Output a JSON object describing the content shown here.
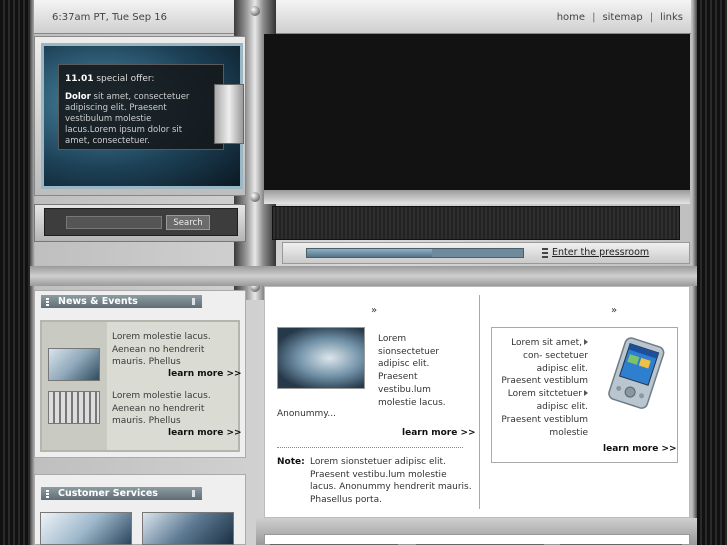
{
  "header": {
    "datetime": "6:37am PT, Tue Sep 16",
    "links": [
      "home",
      "sitemap",
      "links"
    ],
    "separator": "|"
  },
  "promo": {
    "title_number": "11.01",
    "title_text": "special offer:",
    "body_bold": "Dolor",
    "body_text": "sit amet, consectetuer adipiscing elit. Praesent vestibulum molestie lacus.Lorem ipsum dolor sit amet, consectetuer."
  },
  "search": {
    "placeholder": "",
    "button_label": "Search"
  },
  "pressroom": {
    "link_label": "Enter the pressroom",
    "progress": 0.58
  },
  "news": {
    "header": "News & Events",
    "items": [
      {
        "text": "Lorem molestie lacus. Aenean no hendrerit mauris. Phellus",
        "more": "learn more >>"
      },
      {
        "text": "Lorem molestie lacus. Aenean no hendrerit mauris. Phellus",
        "more": "learn more >>"
      }
    ]
  },
  "customer_services": {
    "header": "Customer Services"
  },
  "main": {
    "arrow": "»",
    "article": {
      "text": "Lorem sionsectetuer adipisc elit. Praesent vestibu.lum molestie lacus.",
      "tail": "Anonummy...",
      "more": "learn more >>"
    },
    "note": {
      "label": "Note:",
      "text": "Lorem sionstetuer adipisc elit. Praesent vestibu.lum molestie lacus. Anonummy hendrerit mauris. Phasellus porta."
    },
    "device": {
      "lines": [
        "Lorem sit amet,",
        "con- sectetuer",
        "adipisc elit.",
        "Praesent vestiblum",
        "Lorem sitctetuer",
        "adipisc elit.",
        "Praesent vestiblum",
        "molestie"
      ],
      "more": "learn more >>"
    }
  },
  "colors": {
    "section_header": "#6f7d85",
    "news_box": "#dadbd3",
    "promo_screen": "#1d4258"
  }
}
